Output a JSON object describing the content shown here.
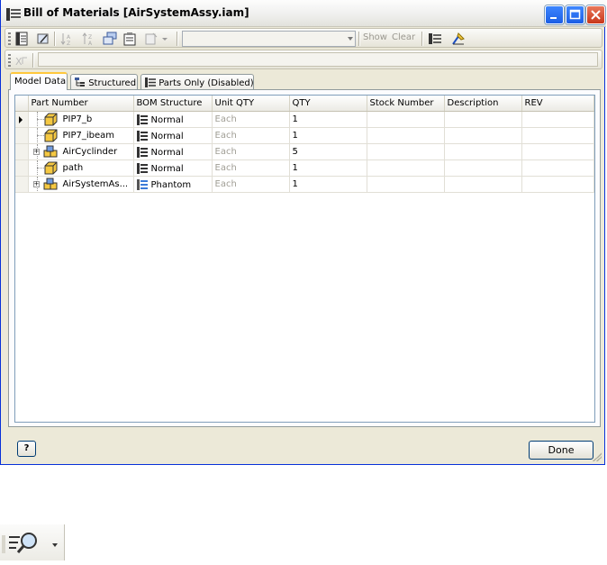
{
  "window": {
    "title": "Bill of Materials [AirSystemAssy.iam]"
  },
  "toolbar": {
    "show_label": "Show",
    "clear_label": "Clear",
    "filter_combo_value": ""
  },
  "tabs": [
    {
      "label": "Model Data"
    },
    {
      "label": "Structured"
    },
    {
      "label": "Parts Only (Disabled)"
    }
  ],
  "table": {
    "columns": [
      "Part Number",
      "BOM Structure",
      "Unit QTY",
      "QTY",
      "Stock Number",
      "Description",
      "REV"
    ],
    "rows": [
      {
        "part_number": "PIP7_b",
        "bom_structure": "Normal",
        "unit_qty": "Each",
        "qty": "1",
        "stock_number": "",
        "description": "",
        "rev": "",
        "type": "part",
        "expandable": false
      },
      {
        "part_number": "PIP7_ibeam",
        "bom_structure": "Normal",
        "unit_qty": "Each",
        "qty": "1",
        "stock_number": "",
        "description": "",
        "rev": "",
        "type": "part",
        "expandable": false
      },
      {
        "part_number": "AirCyclinder",
        "bom_structure": "Normal",
        "unit_qty": "Each",
        "qty": "5",
        "stock_number": "",
        "description": "",
        "rev": "",
        "type": "assembly",
        "expandable": true
      },
      {
        "part_number": "path",
        "bom_structure": "Normal",
        "unit_qty": "Each",
        "qty": "1",
        "stock_number": "",
        "description": "",
        "rev": "",
        "type": "part",
        "expandable": false
      },
      {
        "part_number": "AirSystemAs...",
        "bom_structure": "Phantom",
        "unit_qty": "Each",
        "qty": "1",
        "stock_number": "",
        "description": "",
        "rev": "",
        "type": "assembly",
        "expandable": true
      }
    ]
  },
  "buttons": {
    "help": "?",
    "done": "Done"
  },
  "colors": {
    "titlebar_accent": "#1c5ee4",
    "close_button": "#c8371a",
    "active_tab_highlight": "#ffc83c",
    "part_icon": "#f5c842"
  }
}
